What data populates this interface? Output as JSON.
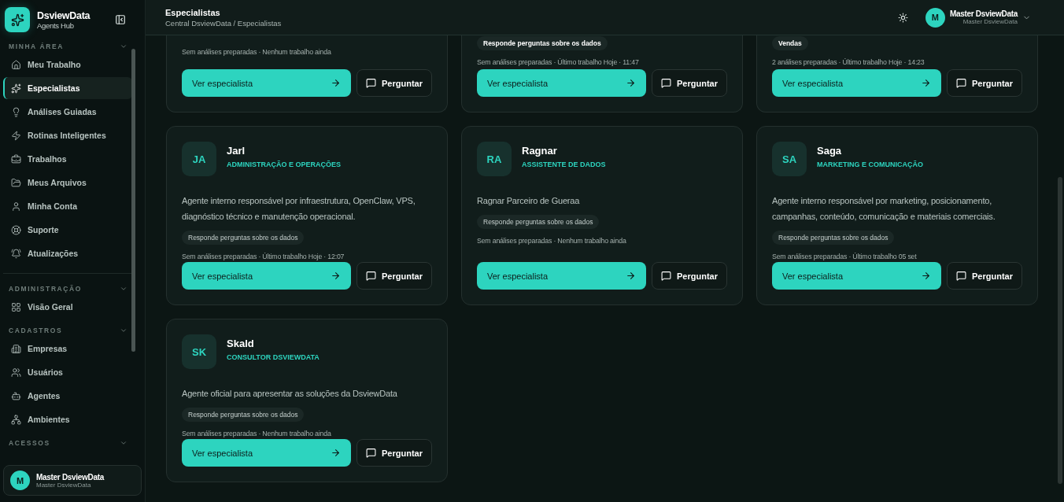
{
  "sidebar": {
    "brand": {
      "name": "DsviewData",
      "subtitle": "Agents Hub"
    },
    "sections": [
      {
        "title": "MINHA ÁREA",
        "items": [
          {
            "label": "Meu Trabalho",
            "selected": false
          },
          {
            "label": "Especialistas",
            "selected": true
          },
          {
            "label": "Análises Guiadas",
            "selected": false
          },
          {
            "label": "Rotinas Inteligentes",
            "selected": false
          },
          {
            "label": "Trabalhos",
            "selected": false
          },
          {
            "label": "Meus Arquivos",
            "selected": false
          },
          {
            "label": "Minha Conta",
            "selected": false
          },
          {
            "label": "Suporte",
            "selected": false
          },
          {
            "label": "Atualizações",
            "selected": false
          }
        ]
      },
      {
        "title": "ADMINISTRAÇÃO",
        "items": [
          {
            "label": "Visão Geral",
            "selected": false
          }
        ]
      },
      {
        "title": "CADASTROS",
        "items": [
          {
            "label": "Empresas",
            "selected": false
          },
          {
            "label": "Usuários",
            "selected": false
          },
          {
            "label": "Agentes",
            "selected": false
          },
          {
            "label": "Ambientes",
            "selected": false
          }
        ]
      },
      {
        "title": "ACESSOS"
      }
    ],
    "user": {
      "initial": "M",
      "name": "Master DsviewData",
      "role": "Master DsviewData"
    }
  },
  "header": {
    "title": "Especialistas",
    "breadcrumb": "Central DsviewData / Especialistas",
    "user": {
      "initial": "M",
      "name": "Master DsviewData",
      "role": "Master DsviewData"
    }
  },
  "cards": [
    {
      "kind": "partial",
      "meta": "Sem análises preparadas · Nenhum trabalho ainda",
      "primary_action": "Ver especialista",
      "secondary_action": "Perguntar"
    },
    {
      "kind": "partial",
      "tags": [
        "Responde perguntas sobre os dados"
      ],
      "meta": "Sem análises preparadas · Último trabalho Hoje · 11:47",
      "primary_action": "Ver especialista",
      "secondary_action": "Perguntar"
    },
    {
      "kind": "partial",
      "tags": [
        "Vendas"
      ],
      "meta": "2 análises preparadas · Último trabalho Hoje · 14:23",
      "primary_action": "Ver especialista",
      "secondary_action": "Perguntar"
    },
    {
      "kind": "full",
      "initials": "JA",
      "name": "Jarl",
      "role": "ADMINISTRAÇÃO E OPERAÇÕES",
      "description": "Agente interno responsável por infraestrutura, OpenClaw, VPS, diagnóstico técnico e manutenção operacional.",
      "tags": [
        "Responde perguntas sobre os dados"
      ],
      "meta": "Sem análises preparadas · Último trabalho Hoje · 12:07",
      "primary_action": "Ver especialista",
      "secondary_action": "Perguntar"
    },
    {
      "kind": "full",
      "initials": "RA",
      "name": "Ragnar",
      "role": "ASSISTENTE DE DADOS",
      "description": "Ragnar Parceiro de Gueraa",
      "tags": [
        "Responde perguntas sobre os dados"
      ],
      "meta": "Sem análises preparadas · Nenhum trabalho ainda",
      "primary_action": "Ver especialista",
      "secondary_action": "Perguntar"
    },
    {
      "kind": "full",
      "initials": "SA",
      "name": "Saga",
      "role": "MARKETING E COMUNICAÇÃO",
      "description": "Agente interno responsável por marketing, posicionamento, campanhas, conteúdo, comunicação e materiais comerciais.",
      "tags": [
        "Responde perguntas sobre os dados"
      ],
      "meta": "Sem análises preparadas · Último trabalho 05 set",
      "primary_action": "Ver especialista",
      "secondary_action": "Perguntar"
    },
    {
      "kind": "full",
      "initials": "SK",
      "name": "Skald",
      "role": "CONSULTOR DSVIEWDATA",
      "description": "Agente oficial para apresentar as soluções da DsviewData",
      "tags": [
        "Responde perguntas sobre os dados"
      ],
      "meta": "Sem análises preparadas · Nenhum trabalho ainda",
      "primary_action": "Ver especialista",
      "secondary_action": "Perguntar"
    }
  ]
}
